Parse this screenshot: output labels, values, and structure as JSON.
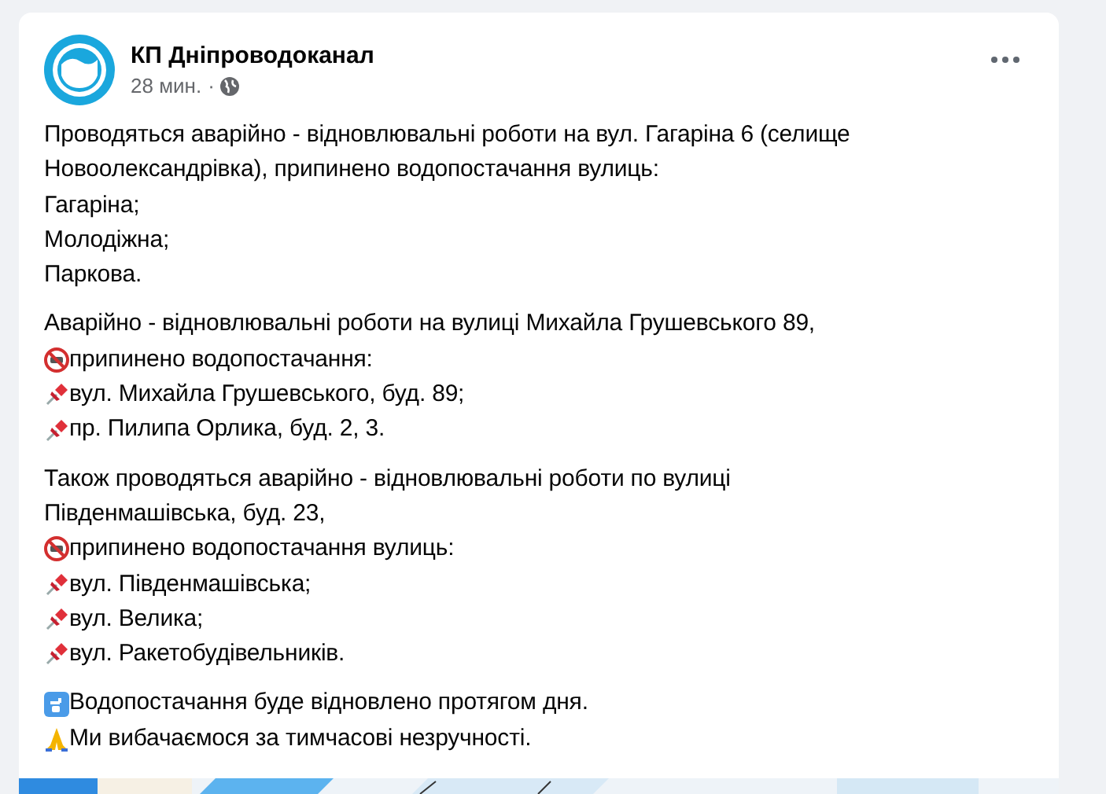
{
  "post": {
    "author": "КП Дніпроводоканал",
    "time": "28 мин.",
    "separator": "·",
    "paragraphs": [
      {
        "lines": [
          {
            "kind": "plain",
            "text": "Проводяться аварійно - відновлювальні роботи на вул. Гагаріна 6 (селище"
          },
          {
            "kind": "plain",
            "text": "Новоолександрівка), припинено водопостачання вулиць:"
          },
          {
            "kind": "plain",
            "text": "Гагаріна;"
          },
          {
            "kind": "plain",
            "text": "Молодіжна;"
          },
          {
            "kind": "plain",
            "text": "Паркова."
          }
        ]
      },
      {
        "lines": [
          {
            "kind": "plain",
            "text": "Аварійно - відновлювальні роботи на вулиці Михайла Грушевського 89,"
          },
          {
            "kind": "no-water",
            "text": "припинено водопостачання:"
          },
          {
            "kind": "pin",
            "text": "вул. Михайла Грушевського, буд. 89;"
          },
          {
            "kind": "pin",
            "text": "пр. Пилипа Орлика, буд. 2, 3."
          }
        ]
      },
      {
        "lines": [
          {
            "kind": "plain",
            "text": "Також проводяться аварійно - відновлювальні роботи по вулиці"
          },
          {
            "kind": "plain",
            "text": "Південмашівська, буд. 23,"
          },
          {
            "kind": "no-water",
            "text": "припинено водопостачання вулиць:"
          },
          {
            "kind": "pin",
            "text": "вул. Південмашівська;"
          },
          {
            "kind": "pin",
            "text": "вул. Велика;"
          },
          {
            "kind": "pin",
            "text": "вул. Ракетобудівельників."
          }
        ]
      },
      {
        "lines": [
          {
            "kind": "tap",
            "text": "Водопостачання буде відновлено протягом дня."
          },
          {
            "kind": "pray",
            "text": "Ми вибачаємося за тимчасові незручності."
          }
        ]
      }
    ]
  }
}
